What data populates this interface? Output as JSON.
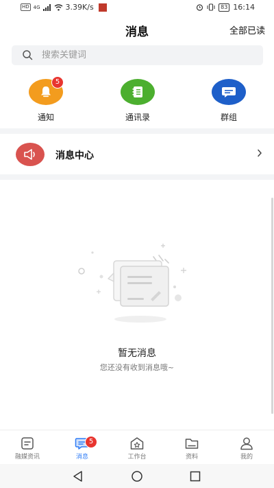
{
  "status_bar": {
    "hd_label": "HD",
    "net_label": "4G",
    "speed": "3.39K/s",
    "battery": "83",
    "time": "16:14"
  },
  "header": {
    "title": "消息",
    "mark_all_read": "全部已读"
  },
  "search": {
    "placeholder": "搜索关键词"
  },
  "quick_entries": [
    {
      "label": "通知",
      "icon": "bell-icon",
      "color": "#f39c1e",
      "badge": "5"
    },
    {
      "label": "通讯录",
      "icon": "address-book-icon",
      "color": "#4caf2f"
    },
    {
      "label": "群组",
      "icon": "chat-bubble-icon",
      "color": "#1e5fc9"
    }
  ],
  "message_center": {
    "label": "消息中心",
    "icon": "speaker-icon",
    "color": "#d9534f"
  },
  "empty_state": {
    "title": "暂无消息",
    "subtitle": "您还没有收到消息哦~"
  },
  "tabs": [
    {
      "label": "融媒资讯",
      "icon": "news-icon"
    },
    {
      "label": "消息",
      "icon": "message-icon",
      "badge": "5",
      "active": true
    },
    {
      "label": "工作台",
      "icon": "workbench-icon"
    },
    {
      "label": "资料",
      "icon": "folder-icon"
    },
    {
      "label": "我的",
      "icon": "user-icon"
    }
  ],
  "colors": {
    "accent": "#2f7cf6",
    "badge": "#e8352f"
  }
}
